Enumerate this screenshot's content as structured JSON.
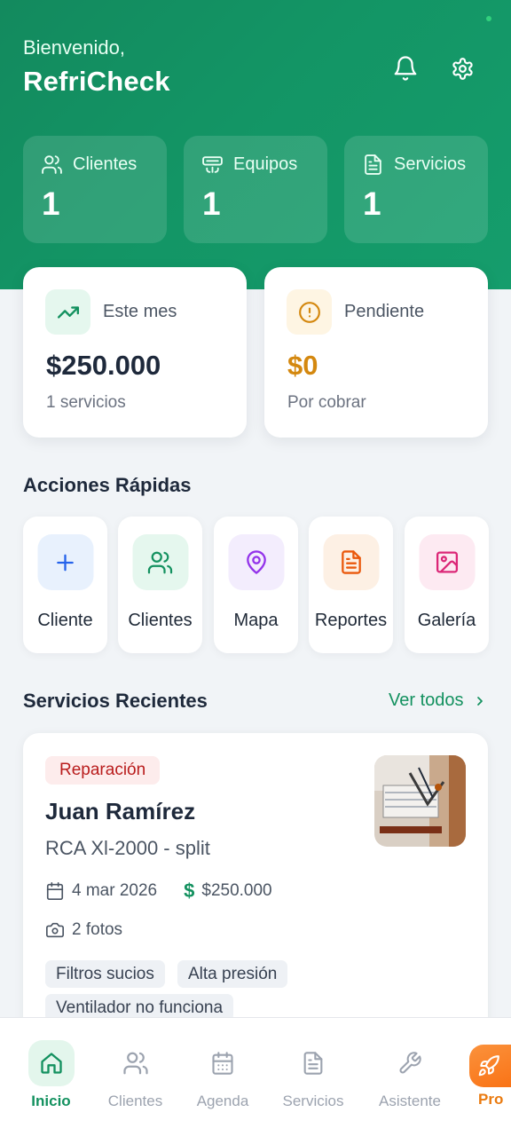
{
  "header": {
    "greeting": "Bienvenido,",
    "app_name": "RefriCheck",
    "notifications_icon": "bell-icon",
    "settings_icon": "gear-icon"
  },
  "stats": [
    {
      "label": "Clientes",
      "value": "1",
      "icon": "users-icon"
    },
    {
      "label": "Equipos",
      "value": "1",
      "icon": "air-conditioner-icon"
    },
    {
      "label": "Servicios",
      "value": "1",
      "icon": "document-icon"
    }
  ],
  "summary": {
    "month": {
      "title": "Este mes",
      "amount": "$250.000",
      "sub": "1 servicios",
      "icon": "trending-up-icon"
    },
    "pending": {
      "title": "Pendiente",
      "amount": "$0",
      "sub": "Por cobrar",
      "icon": "alert-circle-icon"
    }
  },
  "quick_actions": {
    "title": "Acciones Rápidas",
    "items": [
      {
        "label": "Cliente",
        "icon": "plus-icon"
      },
      {
        "label": "Clientes",
        "icon": "users-icon"
      },
      {
        "label": "Mapa",
        "icon": "map-pin-icon"
      },
      {
        "label": "Reportes",
        "icon": "report-icon"
      },
      {
        "label": "Galería",
        "icon": "image-icon"
      }
    ]
  },
  "recent": {
    "title": "Servicios Recientes",
    "see_all": "Ver todos",
    "service": {
      "type": "Reparación",
      "client": "Juan Ramírez",
      "equipment": "RCA Xl-2000 - split",
      "date": "4 mar 2026",
      "amount": "$250.000",
      "photos": "2 fotos",
      "tags": [
        "Filtros sucios",
        "Alta presión",
        "Ventilador no funciona"
      ]
    }
  },
  "nav": {
    "items": [
      {
        "label": "Inicio",
        "icon": "home-icon",
        "active": true
      },
      {
        "label": "Clientes",
        "icon": "users-icon"
      },
      {
        "label": "Agenda",
        "icon": "calendar-icon"
      },
      {
        "label": "Servicios",
        "icon": "document-icon"
      },
      {
        "label": "Asistente",
        "icon": "wrench-icon"
      }
    ],
    "pro_label": "Pro",
    "pro_icon": "rocket-icon"
  },
  "colors": {
    "brand_green": "#13915f",
    "pending_orange": "#d4880f",
    "tag_red": "#b91c1c"
  }
}
